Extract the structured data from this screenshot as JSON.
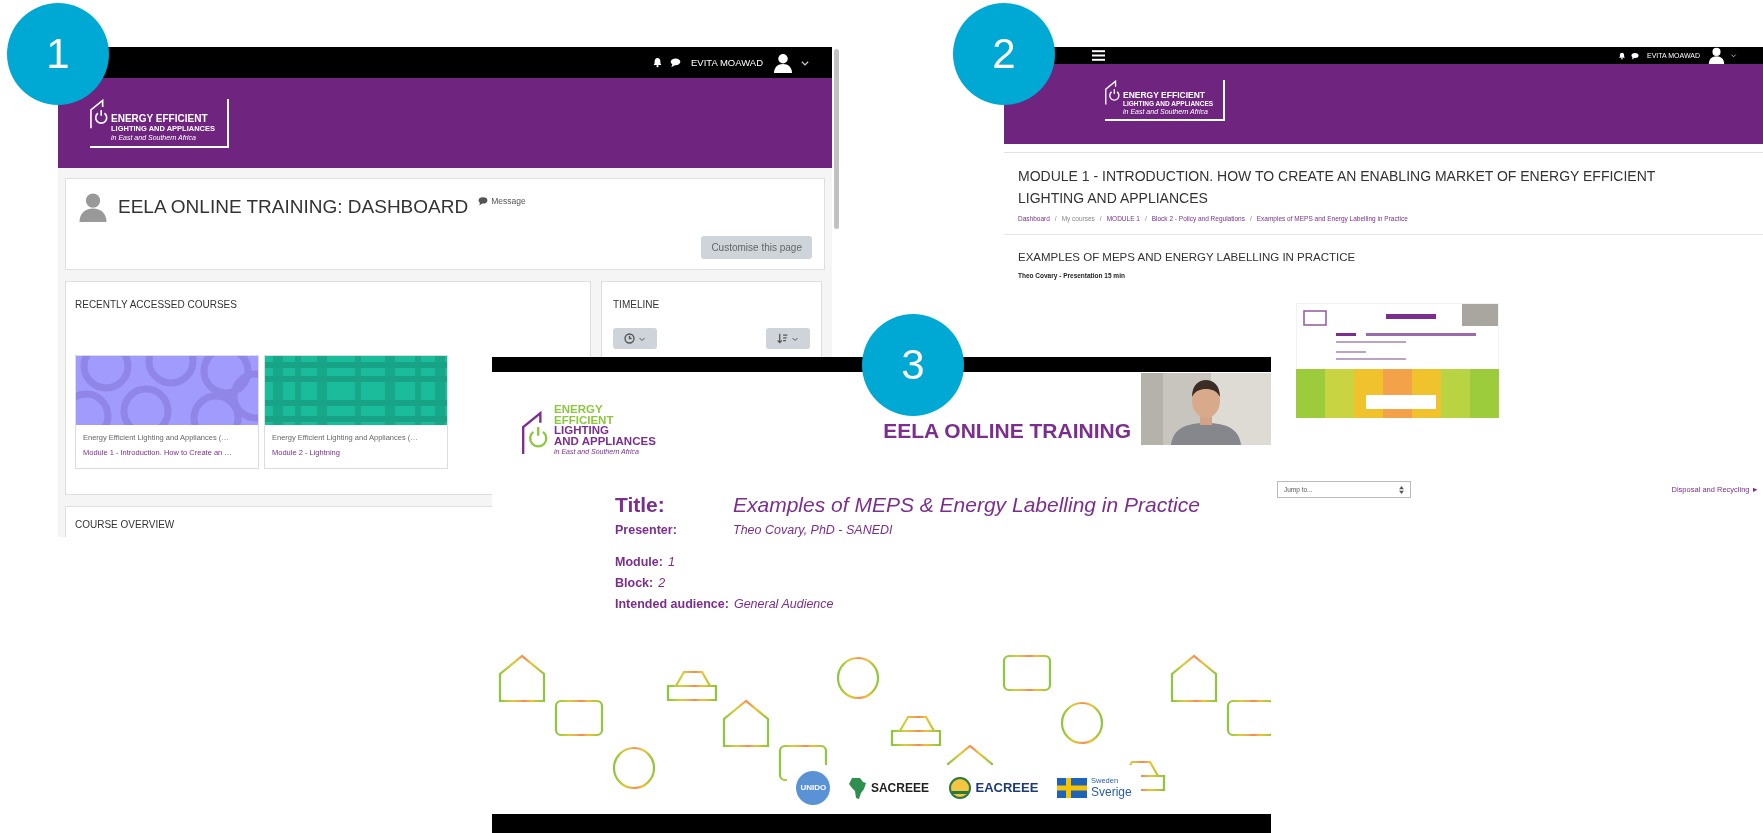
{
  "screen_1": {
    "callout": "1",
    "user_name": "EVITA MOAWAD",
    "logo": {
      "line_1": "ENERGY EFFICIENT",
      "line_2": "LIGHTING AND APPLIANCES",
      "tagline": "in East and Southern Africa"
    },
    "page_title": "EELA ONLINE TRAINING: DASHBOARD",
    "message_link": "Message",
    "customise_button": "Customise this page",
    "recent_courses": {
      "heading": "RECENTLY ACCESSED COURSES",
      "courses": [
        {
          "category": "Energy Efficient Lighting and Appliances (…",
          "name": "Module 1 - Introduction. How to Create an …"
        },
        {
          "category": "Energy Efficient Lighting and Appliances (…",
          "name": "Module 2 - Lightning"
        }
      ]
    },
    "timeline": {
      "heading": "TIMELINE"
    },
    "course_overview": {
      "heading": "COURSE OVERVIEW"
    }
  },
  "screen_2": {
    "callout": "2",
    "user_name": "EVITA MOAWAD",
    "logo": {
      "line_1": "ENERGY EFFICIENT",
      "line_2": "LIGHTING AND APPLIANCES",
      "tagline": "in East and Southern Africa"
    },
    "page_title": "MODULE 1 - INTRODUCTION. HOW TO CREATE AN ENABLING MARKET OF ENERGY EFFICIENT LIGHTING AND APPLIANCES",
    "breadcrumb": {
      "separator": "/",
      "items": [
        {
          "label": "Dashboard",
          "link": true
        },
        {
          "label": "My courses",
          "link": false
        },
        {
          "label": "MODULE 1",
          "link": true
        },
        {
          "label": "Block 2 - Policy and Regulations",
          "link": true
        },
        {
          "label": "Examples of MEPS and Energy Labelling in Practice",
          "link": true
        }
      ]
    },
    "section_title": "EXAMPLES OF MEPS AND ENERGY LABELLING IN PRACTICE",
    "subtitle": "Theo Covary - Presentation 15 min",
    "jump_select": "Jump to...",
    "next_link": "Disposal and Recycling ►"
  },
  "screen_3": {
    "callout": "3",
    "logo_lines": [
      {
        "text": "ENERGY",
        "color": "#8dc63f"
      },
      {
        "text": "EFFICIENT",
        "color": "#8dc63f"
      },
      {
        "text": "LIGHTING",
        "color": "#7b2e8e"
      },
      {
        "text": "AND APPLIANCES",
        "color": "#7b2e8e"
      }
    ],
    "tagline": "in East and Southern Africa",
    "heading": "EELA ONLINE TRAINING",
    "fields": [
      {
        "kind": "heading",
        "label": "Title:",
        "value": "Examples of MEPS & Energy Labelling in Practice"
      },
      {
        "kind": "aligned",
        "label": "Presenter:",
        "value": "Theo Covary, PhD - SANEDI"
      },
      {
        "kind": "inline",
        "label": "Module:",
        "value": "1"
      },
      {
        "kind": "inline",
        "label": "Block:",
        "value": "2"
      },
      {
        "kind": "inline",
        "label": "Intended audience:",
        "value": "General Audience"
      }
    ],
    "partners": [
      {
        "kind": "emblem",
        "name": "UNIDO"
      },
      {
        "kind": "africa",
        "name": "SACREEE"
      },
      {
        "kind": "sun",
        "name": "EACREEE"
      },
      {
        "kind": "flag",
        "caption": "Sweden",
        "name": "Sverige"
      }
    ]
  }
}
